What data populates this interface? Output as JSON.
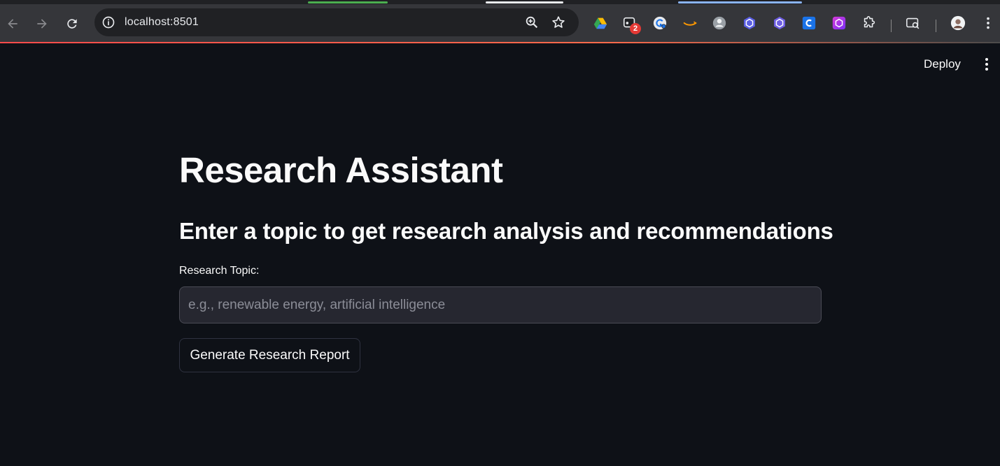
{
  "browser": {
    "url": "localhost:8501",
    "extensions": [
      {
        "name": "google-drive-icon"
      },
      {
        "name": "tab-counter-icon",
        "badge": "2"
      },
      {
        "name": "grammarly-icon"
      },
      {
        "name": "amazon-icon"
      },
      {
        "name": "profile-extension-icon"
      },
      {
        "name": "hexagon-extension-icon"
      },
      {
        "name": "hexagon-extension-2-icon"
      },
      {
        "name": "c-extension-icon"
      },
      {
        "name": "gradient-extension-icon"
      },
      {
        "name": "puzzle-icon"
      }
    ],
    "colors": {
      "toolbar": "#35363a",
      "omnibox": "#202124",
      "accent": "#ff4b4b"
    }
  },
  "header": {
    "deploy_label": "Deploy"
  },
  "main": {
    "title": "Research Assistant",
    "subtitle": "Enter a topic to get research analysis and recommendations",
    "input_label": "Research Topic:",
    "input_value": "",
    "input_placeholder": "e.g., renewable energy, artificial intelligence",
    "button_label": "Generate Research Report"
  },
  "theme": {
    "background": "#0e1117",
    "text": "#fafafa",
    "input_bg": "#262730"
  }
}
